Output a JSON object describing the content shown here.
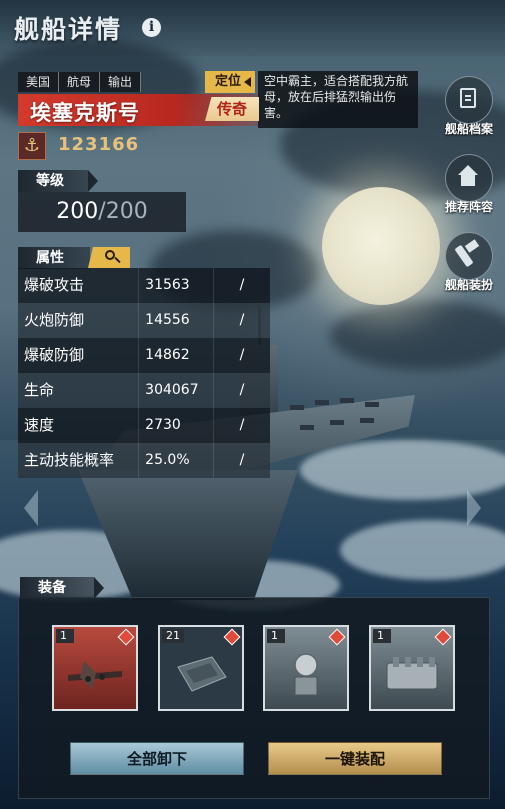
{
  "header": {
    "title": "舰船详情",
    "info_icon": "i"
  },
  "ship": {
    "tags": [
      "美国",
      "航母",
      "输出"
    ],
    "locate_label": "定位",
    "name": "埃塞克斯号",
    "rarity": "传奇",
    "description": "空中霸主，适合搭配我方航母，放在后排猛烈输出伤害。",
    "id": "123166",
    "badge_icon": "anchor-icon"
  },
  "level": {
    "label": "等级",
    "current": "200",
    "separator": "/",
    "max": "200"
  },
  "attributes": {
    "label": "属性",
    "rows": [
      {
        "name": "爆破攻击",
        "value": "31563",
        "extra": "/"
      },
      {
        "name": "火炮防御",
        "value": "14556",
        "extra": "/"
      },
      {
        "name": "爆破防御",
        "value": "14862",
        "extra": "/"
      },
      {
        "name": "生命",
        "value": "304067",
        "extra": "/"
      },
      {
        "name": "速度",
        "value": "2730",
        "extra": "/"
      },
      {
        "name": "主动技能概率",
        "value": "25.0%",
        "extra": "/"
      }
    ]
  },
  "side_menu": [
    {
      "label": "舰船档案",
      "icon": "file-icon"
    },
    {
      "label": "推荐阵容",
      "icon": "home-icon"
    },
    {
      "label": "舰船装扮",
      "icon": "brush-icon"
    }
  ],
  "equipment": {
    "label": "装备",
    "slots": [
      {
        "count": "1",
        "item": "bomber-aircraft",
        "rarity_color": "#b84a3e"
      },
      {
        "count": "21",
        "item": "armor-plate",
        "rarity_color": "#3a4a54"
      },
      {
        "count": "1",
        "item": "radar-dish",
        "rarity_color": "#3a4a54"
      },
      {
        "count": "1",
        "item": "engine",
        "rarity_color": "#3a4a54"
      }
    ],
    "unequip_all": "全部卸下",
    "auto_equip": "一键装配"
  }
}
